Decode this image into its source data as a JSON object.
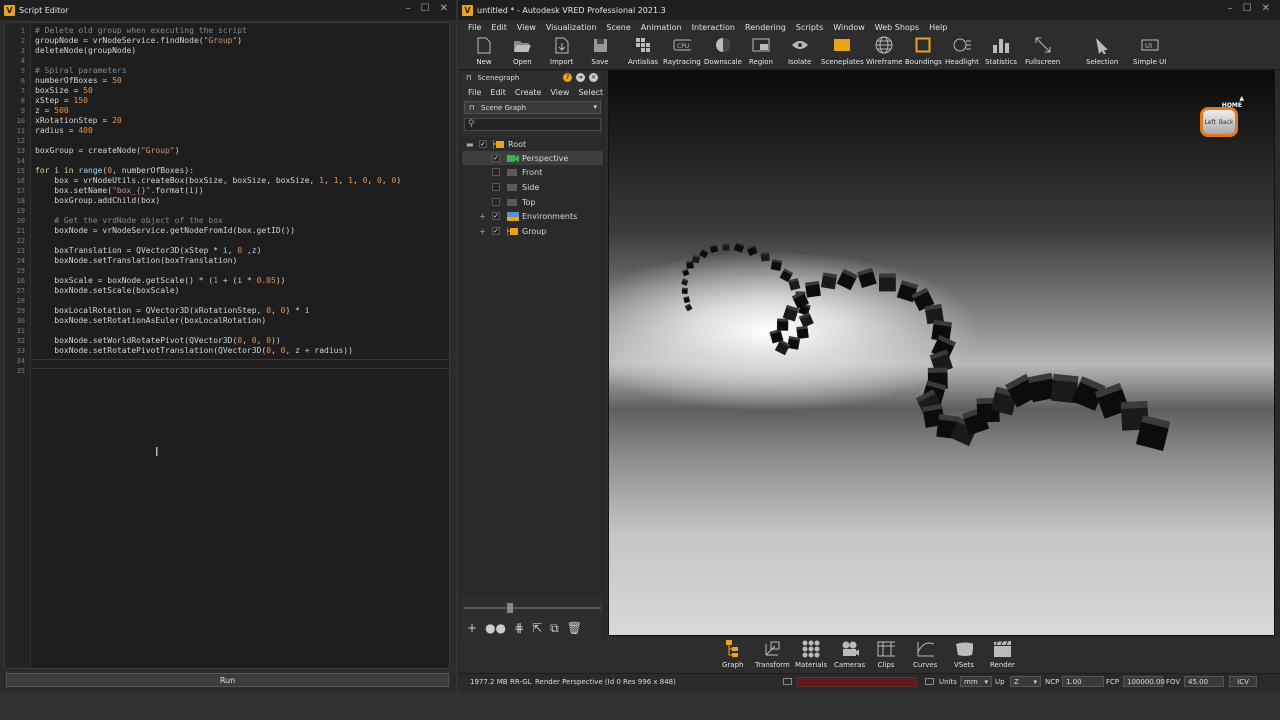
{
  "script_editor": {
    "title": "Script Editor",
    "run_label": "Run",
    "line_numbers": [
      "1",
      "2",
      "3",
      "4",
      "5",
      "6",
      "7",
      "8",
      "9",
      "10",
      "11",
      "12",
      "13",
      "14",
      "15",
      "16",
      "17",
      "18",
      "19",
      "20",
      "21",
      "22",
      "23",
      "24",
      "25",
      "26",
      "27",
      "28",
      "29",
      "30",
      "31",
      "32",
      "33",
      "34",
      "35"
    ],
    "code_lines": [
      "# Delete old group when executing the script",
      "groupNode = vrNodeService.findNode(\"Group\")",
      "deleteNode(groupNode)",
      "",
      "# Spiral parameters",
      "numberOfBoxes = 50",
      "boxSize = 50",
      "xStep = 150",
      "z = 500",
      "xRotationStep = 20",
      "radius = 400",
      "",
      "boxGroup = createNode(\"Group\")",
      "",
      "for i in range(0, numberOfBoxes):",
      "    box = vrNodeUtils.createBox(boxSize, boxSize, boxSize, 1, 1, 1, 0, 0, 0)",
      "    box.setName(\"box_{}\".format(i))",
      "    boxGroup.addChild(box)",
      "",
      "    # Get the vrdNode object of the box",
      "    boxNode = vrNodeService.getNodeFromId(box.getID())",
      "",
      "    boxTranslation = QVector3D(xStep * i, 0 ,z)",
      "    boxNode.setTranslation(boxTranslation)",
      "",
      "    boxScale = boxNode.getScale() * (1 + (i * 0.05))",
      "    boxNode.setScale(boxScale)",
      "",
      "    boxLocalRotation = QVector3D(xRotationStep, 0, 0) * i",
      "    boxNode.setRotationAsEuler(boxLocalRotation)",
      "",
      "    boxNode.setWorldRotatePivot(QVector3D(0, 0, 0))",
      "    boxNode.setRotatePivotTranslation(QVector3D(0, 0, z + radius))",
      "",
      ""
    ]
  },
  "vred": {
    "title": "untitled * - Autodesk VRED Professional 2021.3",
    "menu": [
      "File",
      "Edit",
      "View",
      "Visualization",
      "Scene",
      "Animation",
      "Interaction",
      "Rendering",
      "Scripts",
      "Window",
      "Web Shops",
      "Help"
    ],
    "toolbar": [
      "New",
      "Open",
      "Import",
      "Save",
      "Antialias",
      "Raytracing",
      "Downscale",
      "Region",
      "Isolate",
      "Sceneplates",
      "Wireframe",
      "Boundings",
      "Headlight",
      "Statistics",
      "Fullscreen",
      "Selection",
      "Simple UI"
    ],
    "scenegraph": {
      "title": "Scenegraph",
      "menu": [
        "File",
        "Edit",
        "Create",
        "View",
        "Select"
      ],
      "dropdown_value": "Scene Graph",
      "nodes": [
        "Root",
        "Perspective",
        "Front",
        "Side",
        "Top",
        "Environments",
        "Group"
      ]
    },
    "viewcube": {
      "home": "HOME",
      "left": "Left",
      "back": "Back"
    },
    "dock": [
      "Graph",
      "Transform",
      "Materials",
      "Cameras",
      "Clips",
      "Curves",
      "VSets",
      "Render"
    ],
    "status": {
      "memory": "1977.2 MB",
      "renderer": "RR-GL",
      "render_info": "Render Perspective (Id 0 Res 996 x 848)",
      "units_label": "Units",
      "units_value": "mm",
      "up_label": "Up",
      "up_value": "Z",
      "ncp_label": "NCP",
      "ncp_value": "1.00",
      "fcp_label": "FCP",
      "fcp_value": "100000.00",
      "fov_label": "FOV",
      "fov_value": "45.00",
      "icv_label": "ICV"
    },
    "accent_color": "#e9a21c"
  }
}
